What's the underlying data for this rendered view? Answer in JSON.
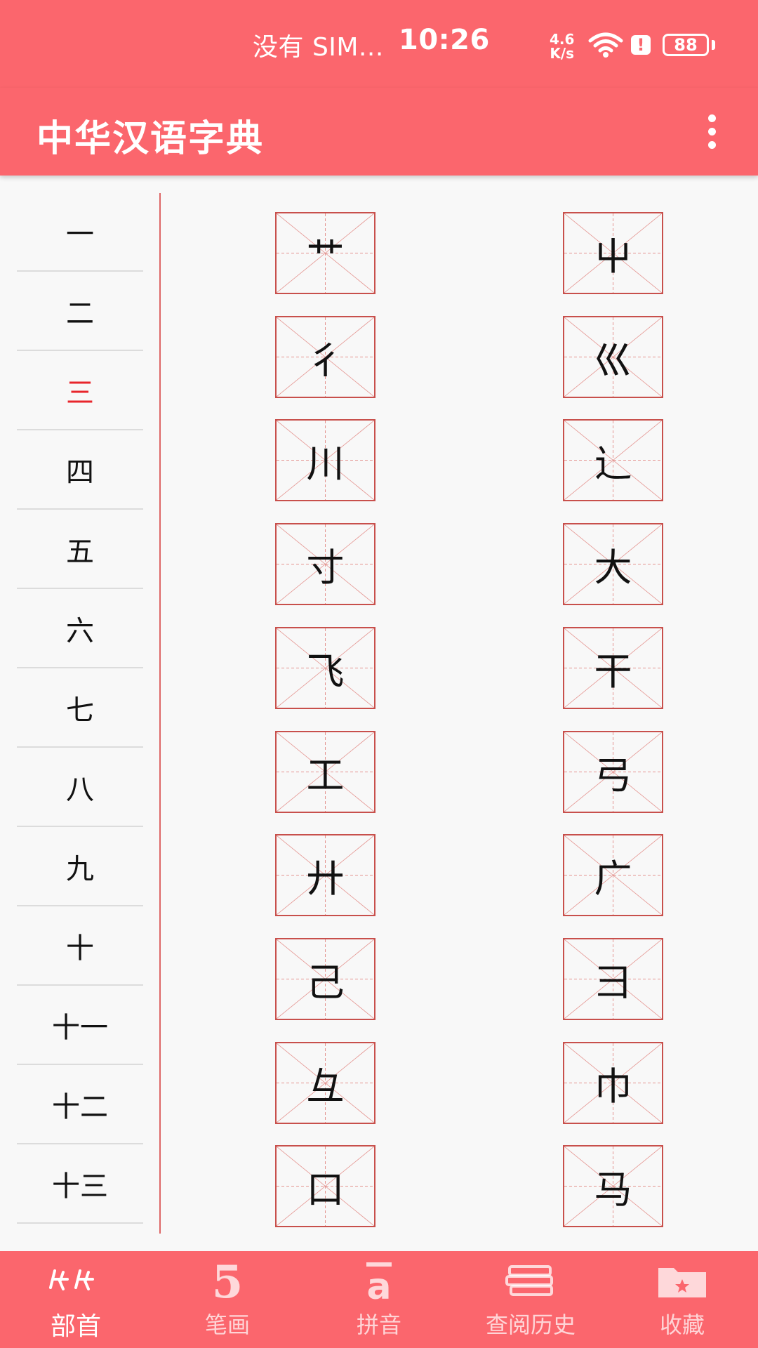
{
  "status_bar": {
    "carrier": "没有 SIM...",
    "time": "10:26",
    "speed_value": "4.6",
    "speed_unit": "K/s",
    "battery": "88"
  },
  "app_bar": {
    "title": "中华汉语字典"
  },
  "stroke_counts": {
    "active_index": 2,
    "items": [
      "一",
      "二",
      "三",
      "四",
      "五",
      "六",
      "七",
      "八",
      "九",
      "十",
      "十一",
      "十二",
      "十三"
    ]
  },
  "radicals": [
    "艹",
    "屮",
    "彳",
    "巛",
    "川",
    "辶",
    "寸",
    "大",
    "飞",
    "干",
    "工",
    "弓",
    "廾",
    "广",
    "己",
    "彐",
    "彑",
    "巾",
    "口",
    "马"
  ],
  "bottom_nav": {
    "items": [
      {
        "label": "部首",
        "icon": "radical-icon",
        "active": true
      },
      {
        "label": "笔画",
        "icon": "stroke-five-icon",
        "active": false
      },
      {
        "label": "拼音",
        "icon": "pinyin-a-icon",
        "active": false
      },
      {
        "label": "查阅历史",
        "icon": "books-icon",
        "active": false
      },
      {
        "label": "收藏",
        "icon": "folder-star-icon",
        "active": false
      }
    ]
  },
  "colors": {
    "brand": "#fb666d",
    "active_text": "#e8262c",
    "cell_border": "#c8504c"
  }
}
